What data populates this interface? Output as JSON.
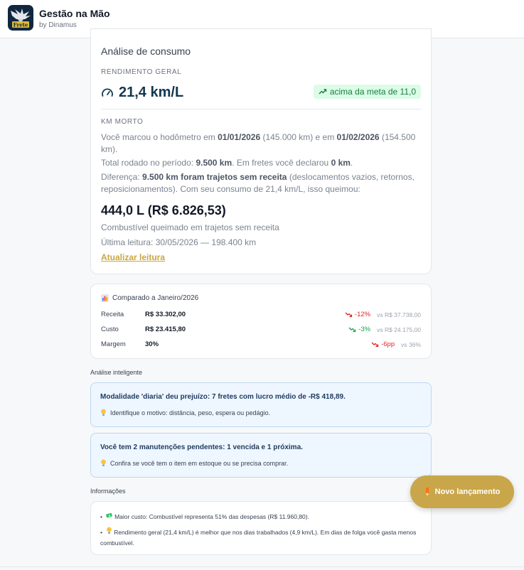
{
  "header": {
    "title": "Gestão na Mão",
    "subtitle": "by Dinamus",
    "logo_text": "Frete"
  },
  "consumo": {
    "title": "Análise de consumo",
    "rendimento_label": "RENDIMENTO GERAL",
    "rendimento_value": "21,4 km/L",
    "meta_badge": "acima da meta de 11,0",
    "km_morto_label": "KM MORTO",
    "p1_a": "Você marcou o hodômetro em ",
    "p1_date1": "01/01/2026",
    "p1_b": " (145.000 km) e em ",
    "p1_date2": "01/02/2026",
    "p1_c": " (154.500 km).",
    "p2_a": "Total rodado no período: ",
    "p2_km": "9.500 km",
    "p2_b": ". Em fretes você declarou ",
    "p2_decl": "0 km",
    "p2_c": ".",
    "p3_a": "Diferença: ",
    "p3_bold": "9.500 km foram trajetos sem receita",
    "p3_b": " (deslocamentos vazios, retornos, reposicionamentos). Com seu consumo de 21,4 km/L, isso queimou:",
    "big_value": "444,0 L (R$ 6.826,53)",
    "burn_caption": "Combustível queimado em trajetos sem receita",
    "last_reading": "Última leitura: 30/05/2026 — 198.400 km",
    "update_link": "Atualizar leitura"
  },
  "comparado": {
    "title": "Comparado a Janeiro/2026",
    "rows": [
      {
        "label": "Receita",
        "value": "R$ 33.302,00",
        "change": "-12%",
        "vs": "vs R$ 37.738,00",
        "trend": "down",
        "color": "#dc2626"
      },
      {
        "label": "Custo",
        "value": "R$ 23.415,80",
        "change": "-3%",
        "vs": "vs R$ 24.175,00",
        "trend": "down",
        "color": "#16a34a"
      },
      {
        "label": "Margem",
        "value": "30%",
        "change": "-6pp",
        "vs": "vs 36%",
        "trend": "down",
        "color": "#dc2626"
      }
    ]
  },
  "analise": {
    "label": "Análise inteligente",
    "items": [
      {
        "title": "Modalidade 'diaria' deu prejuízo: 7 fretes com lucro médio de -R$ 418,89.",
        "tip": "Identifique o motivo: distância, peso, espera ou pedágio."
      },
      {
        "title": "Você tem 2 manutenções pendentes: 1 vencida e 1 próxima.",
        "tip": "Confira se você tem o item em estoque ou se precisa comprar."
      }
    ]
  },
  "informacoes": {
    "label": "Informações",
    "items": [
      "Maior custo: Combustível representa 51% das despesas (R$ 11.960,80).",
      "Rendimento geral (21,4 km/L) é melhor que nos dias trabalhados (4,9 km/L). Em dias de folga você gasta menos combustível."
    ]
  },
  "fab": {
    "label": "Novo lançamento"
  },
  "colors": {
    "navy": "#12374f",
    "gold": "#c9a649",
    "green_badge": "#dcfce7",
    "insight_bg": "#eef6ff"
  }
}
